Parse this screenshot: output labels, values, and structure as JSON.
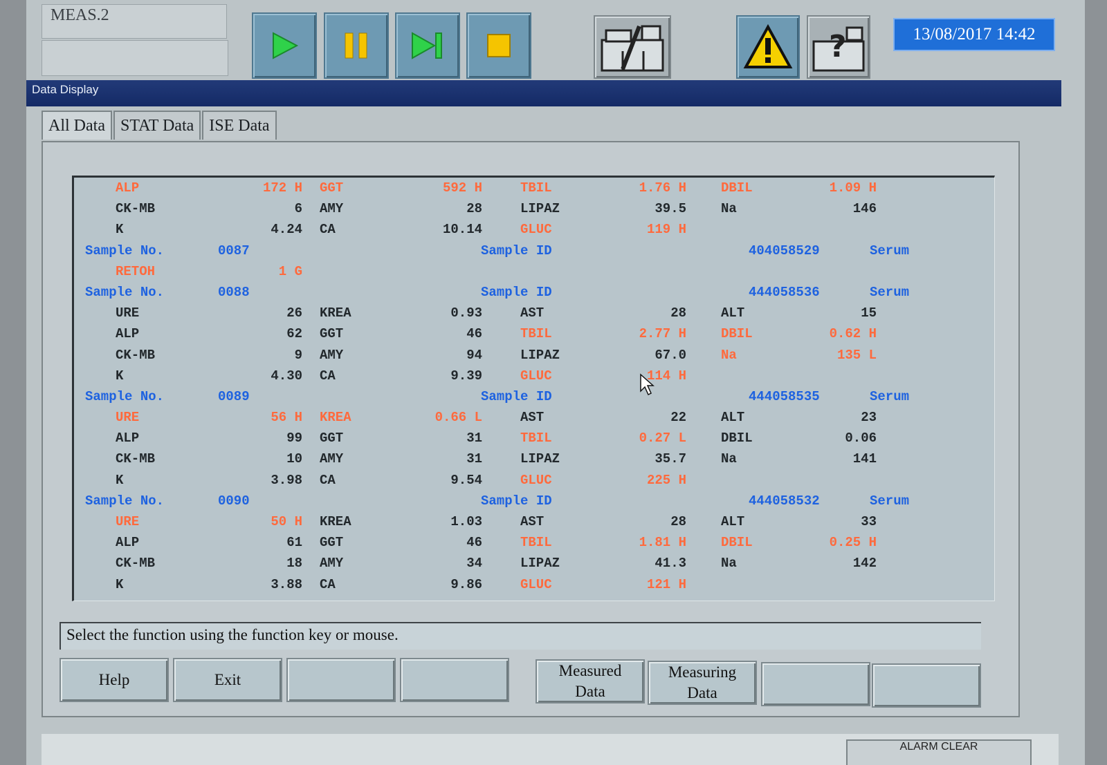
{
  "header": {
    "mode_label": "MEAS.2",
    "datetime": "13/08/2017 14:42"
  },
  "toolbar": {
    "play_icon": "play-icon",
    "pause_icon": "pause-icon",
    "step_icon": "step-forward-icon",
    "stop_icon": "stop-icon",
    "maintenance_icon": "analyzer-wrench-icon",
    "alarm_icon": "warning-icon",
    "help_icon": "analyzer-question-icon"
  },
  "window_title": "Data Display",
  "tabs": [
    "All Data",
    "STAT Data",
    "ISE Data"
  ],
  "rows": [
    {
      "type": "data",
      "cells": [
        [
          "ALP",
          "172 H",
          "r"
        ],
        [
          "GGT",
          "592 H",
          "r"
        ],
        [
          "TBIL",
          "1.76 H",
          "r"
        ],
        [
          "DBIL",
          "1.09 H",
          "r"
        ]
      ]
    },
    {
      "type": "data",
      "cells": [
        [
          "CK-MB",
          "6",
          "d"
        ],
        [
          "AMY",
          "28",
          "d"
        ],
        [
          "LIPAZ",
          "39.5",
          "d"
        ],
        [
          "Na",
          "146",
          "d"
        ]
      ]
    },
    {
      "type": "data",
      "cells": [
        [
          "K",
          "4.24",
          "d"
        ],
        [
          "CA",
          "10.14",
          "d"
        ],
        [
          "GLUC",
          "119 H",
          "r"
        ]
      ]
    },
    {
      "type": "sample",
      "label": "Sample No.",
      "no": "0087",
      "id_label": "Sample ID",
      "id": "404058529",
      "kind": "Serum"
    },
    {
      "type": "data",
      "cells": [
        [
          "RETOH",
          "1 G",
          "r"
        ]
      ]
    },
    {
      "type": "sample",
      "label": "Sample No.",
      "no": "0088",
      "id_label": "Sample ID",
      "id": "444058536",
      "kind": "Serum"
    },
    {
      "type": "data",
      "cells": [
        [
          "URE",
          "26",
          "d"
        ],
        [
          "KREA",
          "0.93",
          "d"
        ],
        [
          "AST",
          "28",
          "d"
        ],
        [
          "ALT",
          "15",
          "d"
        ]
      ]
    },
    {
      "type": "data",
      "cells": [
        [
          "ALP",
          "62",
          "d"
        ],
        [
          "GGT",
          "46",
          "d"
        ],
        [
          "TBIL",
          "2.77 H",
          "r"
        ],
        [
          "DBIL",
          "0.62 H",
          "r"
        ]
      ]
    },
    {
      "type": "data",
      "cells": [
        [
          "CK-MB",
          "9",
          "d"
        ],
        [
          "AMY",
          "94",
          "d"
        ],
        [
          "LIPAZ",
          "67.0",
          "d"
        ],
        [
          "Na",
          "135 L",
          "r"
        ]
      ]
    },
    {
      "type": "data",
      "cells": [
        [
          "K",
          "4.30",
          "d"
        ],
        [
          "CA",
          "9.39",
          "d"
        ],
        [
          "GLUC",
          "114 H",
          "r"
        ]
      ]
    },
    {
      "type": "sample",
      "label": "Sample No.",
      "no": "0089",
      "id_label": "Sample ID",
      "id": "444058535",
      "kind": "Serum"
    },
    {
      "type": "data",
      "cells": [
        [
          "URE",
          "56 H",
          "r"
        ],
        [
          "KREA",
          "0.66 L",
          "r"
        ],
        [
          "AST",
          "22",
          "d"
        ],
        [
          "ALT",
          "23",
          "d"
        ]
      ]
    },
    {
      "type": "data",
      "cells": [
        [
          "ALP",
          "99",
          "d"
        ],
        [
          "GGT",
          "31",
          "d"
        ],
        [
          "TBIL",
          "0.27 L",
          "r"
        ],
        [
          "DBIL",
          "0.06",
          "d"
        ]
      ]
    },
    {
      "type": "data",
      "cells": [
        [
          "CK-MB",
          "10",
          "d"
        ],
        [
          "AMY",
          "31",
          "d"
        ],
        [
          "LIPAZ",
          "35.7",
          "d"
        ],
        [
          "Na",
          "141",
          "d"
        ]
      ]
    },
    {
      "type": "data",
      "cells": [
        [
          "K",
          "3.98",
          "d"
        ],
        [
          "CA",
          "9.54",
          "d"
        ],
        [
          "GLUC",
          "225 H",
          "r"
        ]
      ]
    },
    {
      "type": "sample",
      "label": "Sample No.",
      "no": "0090",
      "id_label": "Sample ID",
      "id": "444058532",
      "kind": "Serum"
    },
    {
      "type": "data",
      "cells": [
        [
          "URE",
          "50 H",
          "r"
        ],
        [
          "KREA",
          "1.03",
          "d"
        ],
        [
          "AST",
          "28",
          "d"
        ],
        [
          "ALT",
          "33",
          "d"
        ]
      ]
    },
    {
      "type": "data",
      "cells": [
        [
          "ALP",
          "61",
          "d"
        ],
        [
          "GGT",
          "46",
          "d"
        ],
        [
          "TBIL",
          "1.81 H",
          "r"
        ],
        [
          "DBIL",
          "0.25 H",
          "r"
        ]
      ]
    },
    {
      "type": "data",
      "cells": [
        [
          "CK-MB",
          "18",
          "d"
        ],
        [
          "AMY",
          "34",
          "d"
        ],
        [
          "LIPAZ",
          "41.3",
          "d"
        ],
        [
          "Na",
          "142",
          "d"
        ]
      ]
    },
    {
      "type": "data",
      "cells": [
        [
          "K",
          "3.88",
          "d"
        ],
        [
          "CA",
          "9.86",
          "d"
        ],
        [
          "GLUC",
          "121 H",
          "r"
        ]
      ]
    }
  ],
  "status_message": "Select the function using the function key or mouse.",
  "function_keys": [
    "Help",
    "Exit",
    "",
    "",
    "Measured\nData",
    "Measuring\nData",
    "",
    ""
  ],
  "alarm_button": "ALARM CLEAR",
  "colors": {
    "blue_text": "#1e62e0",
    "abnormal": "#ff6a3d",
    "datetime_bg": "#1f6fd8"
  }
}
